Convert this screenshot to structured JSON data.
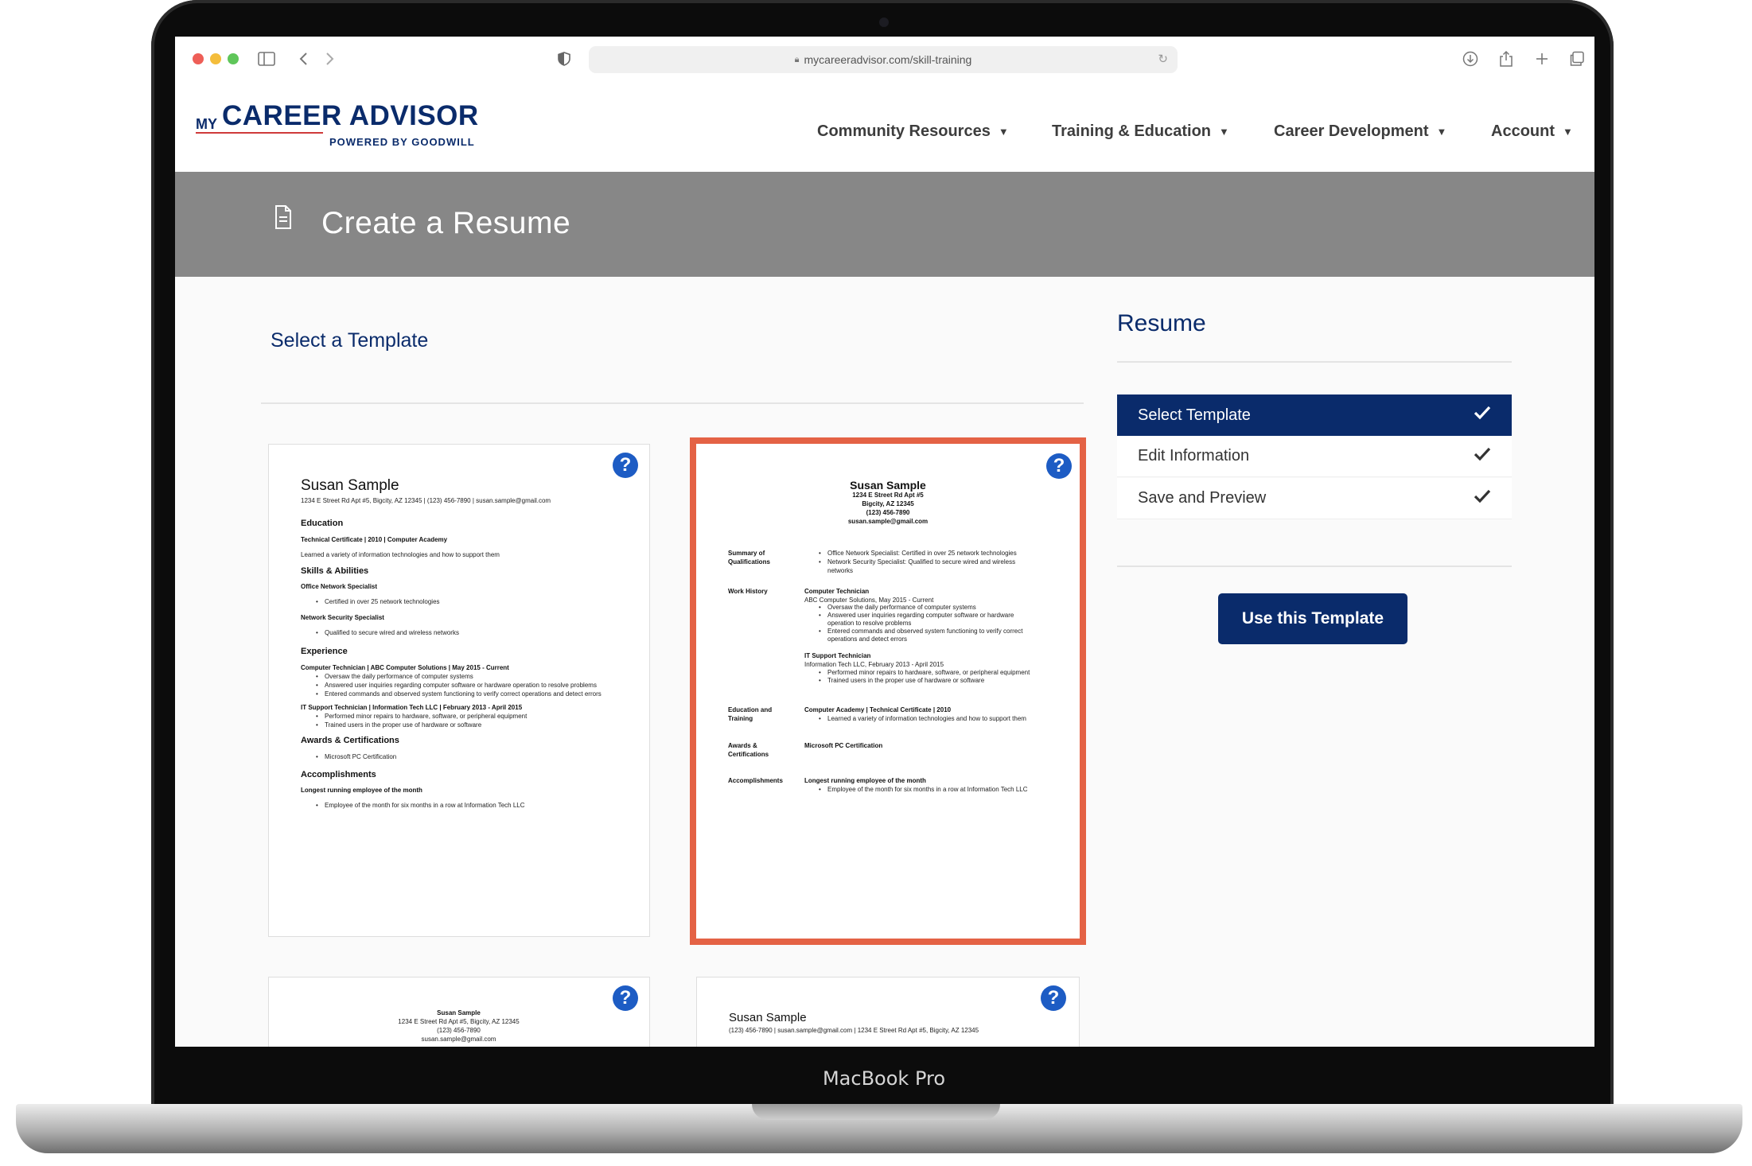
{
  "browser": {
    "url": "mycareeradvisor.com/skill-training",
    "traffic_lights": {
      "close": "#ee5e57",
      "minimize": "#f4bd3b",
      "zoom": "#5fc65a"
    },
    "icons": [
      "sidebar-icon",
      "back-icon",
      "forward-icon",
      "shield-icon",
      "download-icon",
      "share-icon",
      "new-tab-icon",
      "tabs-icon"
    ]
  },
  "device": {
    "model": "MacBook Pro"
  },
  "brand": {
    "my": "MY",
    "name": "CAREER ADVISOR",
    "tagline": "POWERED BY GOODWILL",
    "color": "#0a2b6b",
    "accent": "#cf3a3a"
  },
  "nav": {
    "items": [
      "Community Resources",
      "Training & Education",
      "Career Development",
      "Account"
    ]
  },
  "banner": {
    "title": "Create a Resume",
    "icon": "document-icon"
  },
  "main": {
    "section_title": "Select a Template"
  },
  "sidebar": {
    "title": "Resume",
    "steps": [
      {
        "label": "Select Template",
        "active": true,
        "done": true
      },
      {
        "label": "Edit Information",
        "active": false,
        "done": true
      },
      {
        "label": "Save and Preview",
        "active": false,
        "done": true
      }
    ],
    "cta": "Use this Template"
  },
  "templates": {
    "help_icon": "?",
    "selected_border_color": "#e46245",
    "t1": {
      "name": "Susan Sample",
      "contact": "1234 E Street Rd Apt #5, Bigcity, AZ 12345  |  (123) 456-7890 | susan.sample@gmail.com",
      "h_education": "Education",
      "edu_line": "Technical Certificate | 2010 | Computer Academy",
      "edu_desc": "Learned a variety of information technologies and how to support them",
      "h_skills": "Skills & Abilities",
      "skill1": "Office Network Specialist",
      "skill1_b": "Certified in over 25 network technologies",
      "skill2": "Network Security Specialist",
      "skill2_b": "Qualified to secure wired and wireless networks",
      "h_experience": "Experience",
      "job1": "Computer Technician | ABC Computer Solutions | May 2015 - Current",
      "job1_b1": "Oversaw the daily performance of computer systems",
      "job1_b2": "Answered user inquiries regarding computer software or hardware operation to resolve problems",
      "job1_b3": "Entered commands and observed system functioning to verify correct operations and detect errors",
      "job2": "IT Support Technician | Information Tech LLC | February 2013 - April 2015",
      "job2_b1": "Performed minor repairs to hardware, software, or peripheral equipment",
      "job2_b2": "Trained users in the proper use of hardware or software",
      "h_awards": "Awards & Certifications",
      "award1": "Microsoft PC Certification",
      "h_accomplishments": "Accomplishments",
      "acc1": "Longest running employee of the month",
      "acc1_b": "Employee of the month for six months in a row at Information Tech LLC"
    },
    "t2": {
      "name": "Susan Sample",
      "addr": "1234 E Street Rd Apt #5",
      "city": "Bigcity, AZ 12345",
      "phone": "(123) 456-7890",
      "email": "susan.sample@gmail.com",
      "l_summary_1": "Summary of",
      "l_summary_2": "Qualifications",
      "sum_b1": "Office Network Specialist: Certified in over 25 network technologies",
      "sum_b2": "Network Security Specialist: Qualified to secure wired and wireless",
      "sum_b2b": "networks",
      "l_work": "Work History",
      "job1_title": "Computer Technician",
      "job1_co": "ABC Computer Solutions, May 2015 - Current",
      "job1_b1": "Oversaw the daily performance of computer systems",
      "job1_b2": "Answered user inquiries regarding computer software or hardware",
      "job1_b2b": "operation to resolve problems",
      "job1_b3": "Entered commands and observed system functioning to verify correct",
      "job1_b3b": "operations and detect errors",
      "job2_title": "IT Support Technician",
      "job2_co": "Information Tech LLC, February 2013 - April 2015",
      "job2_b1": "Performed minor repairs to hardware, software, or peripheral equipment",
      "job2_b2": "Trained users in the proper use of hardware or software",
      "l_edu_1": "Education and",
      "l_edu_2": "Training",
      "edu_line": "Computer Academy | Technical Certificate | 2010",
      "edu_b": "Learned a variety of information technologies and how to support them",
      "l_awards_1": "Awards &",
      "l_awards_2": "Certifications",
      "award1": "Microsoft PC Certification",
      "l_acc": "Accomplishments",
      "acc1": "Longest running employee of the month",
      "acc1_b": "Employee of the month for six months in a row at Information Tech LLC"
    },
    "t3": {
      "name": "Susan Sample",
      "line1": "1234 E Street Rd Apt #5, Bigcity, AZ 12345",
      "line2": "(123) 456-7890",
      "line3": "susan.sample@gmail.com"
    },
    "t4": {
      "name": "Susan Sample",
      "contact": "(123) 456-7890 | susan.sample@gmail.com | 1234 E Street Rd Apt #5, Bigcity, AZ 12345"
    }
  }
}
